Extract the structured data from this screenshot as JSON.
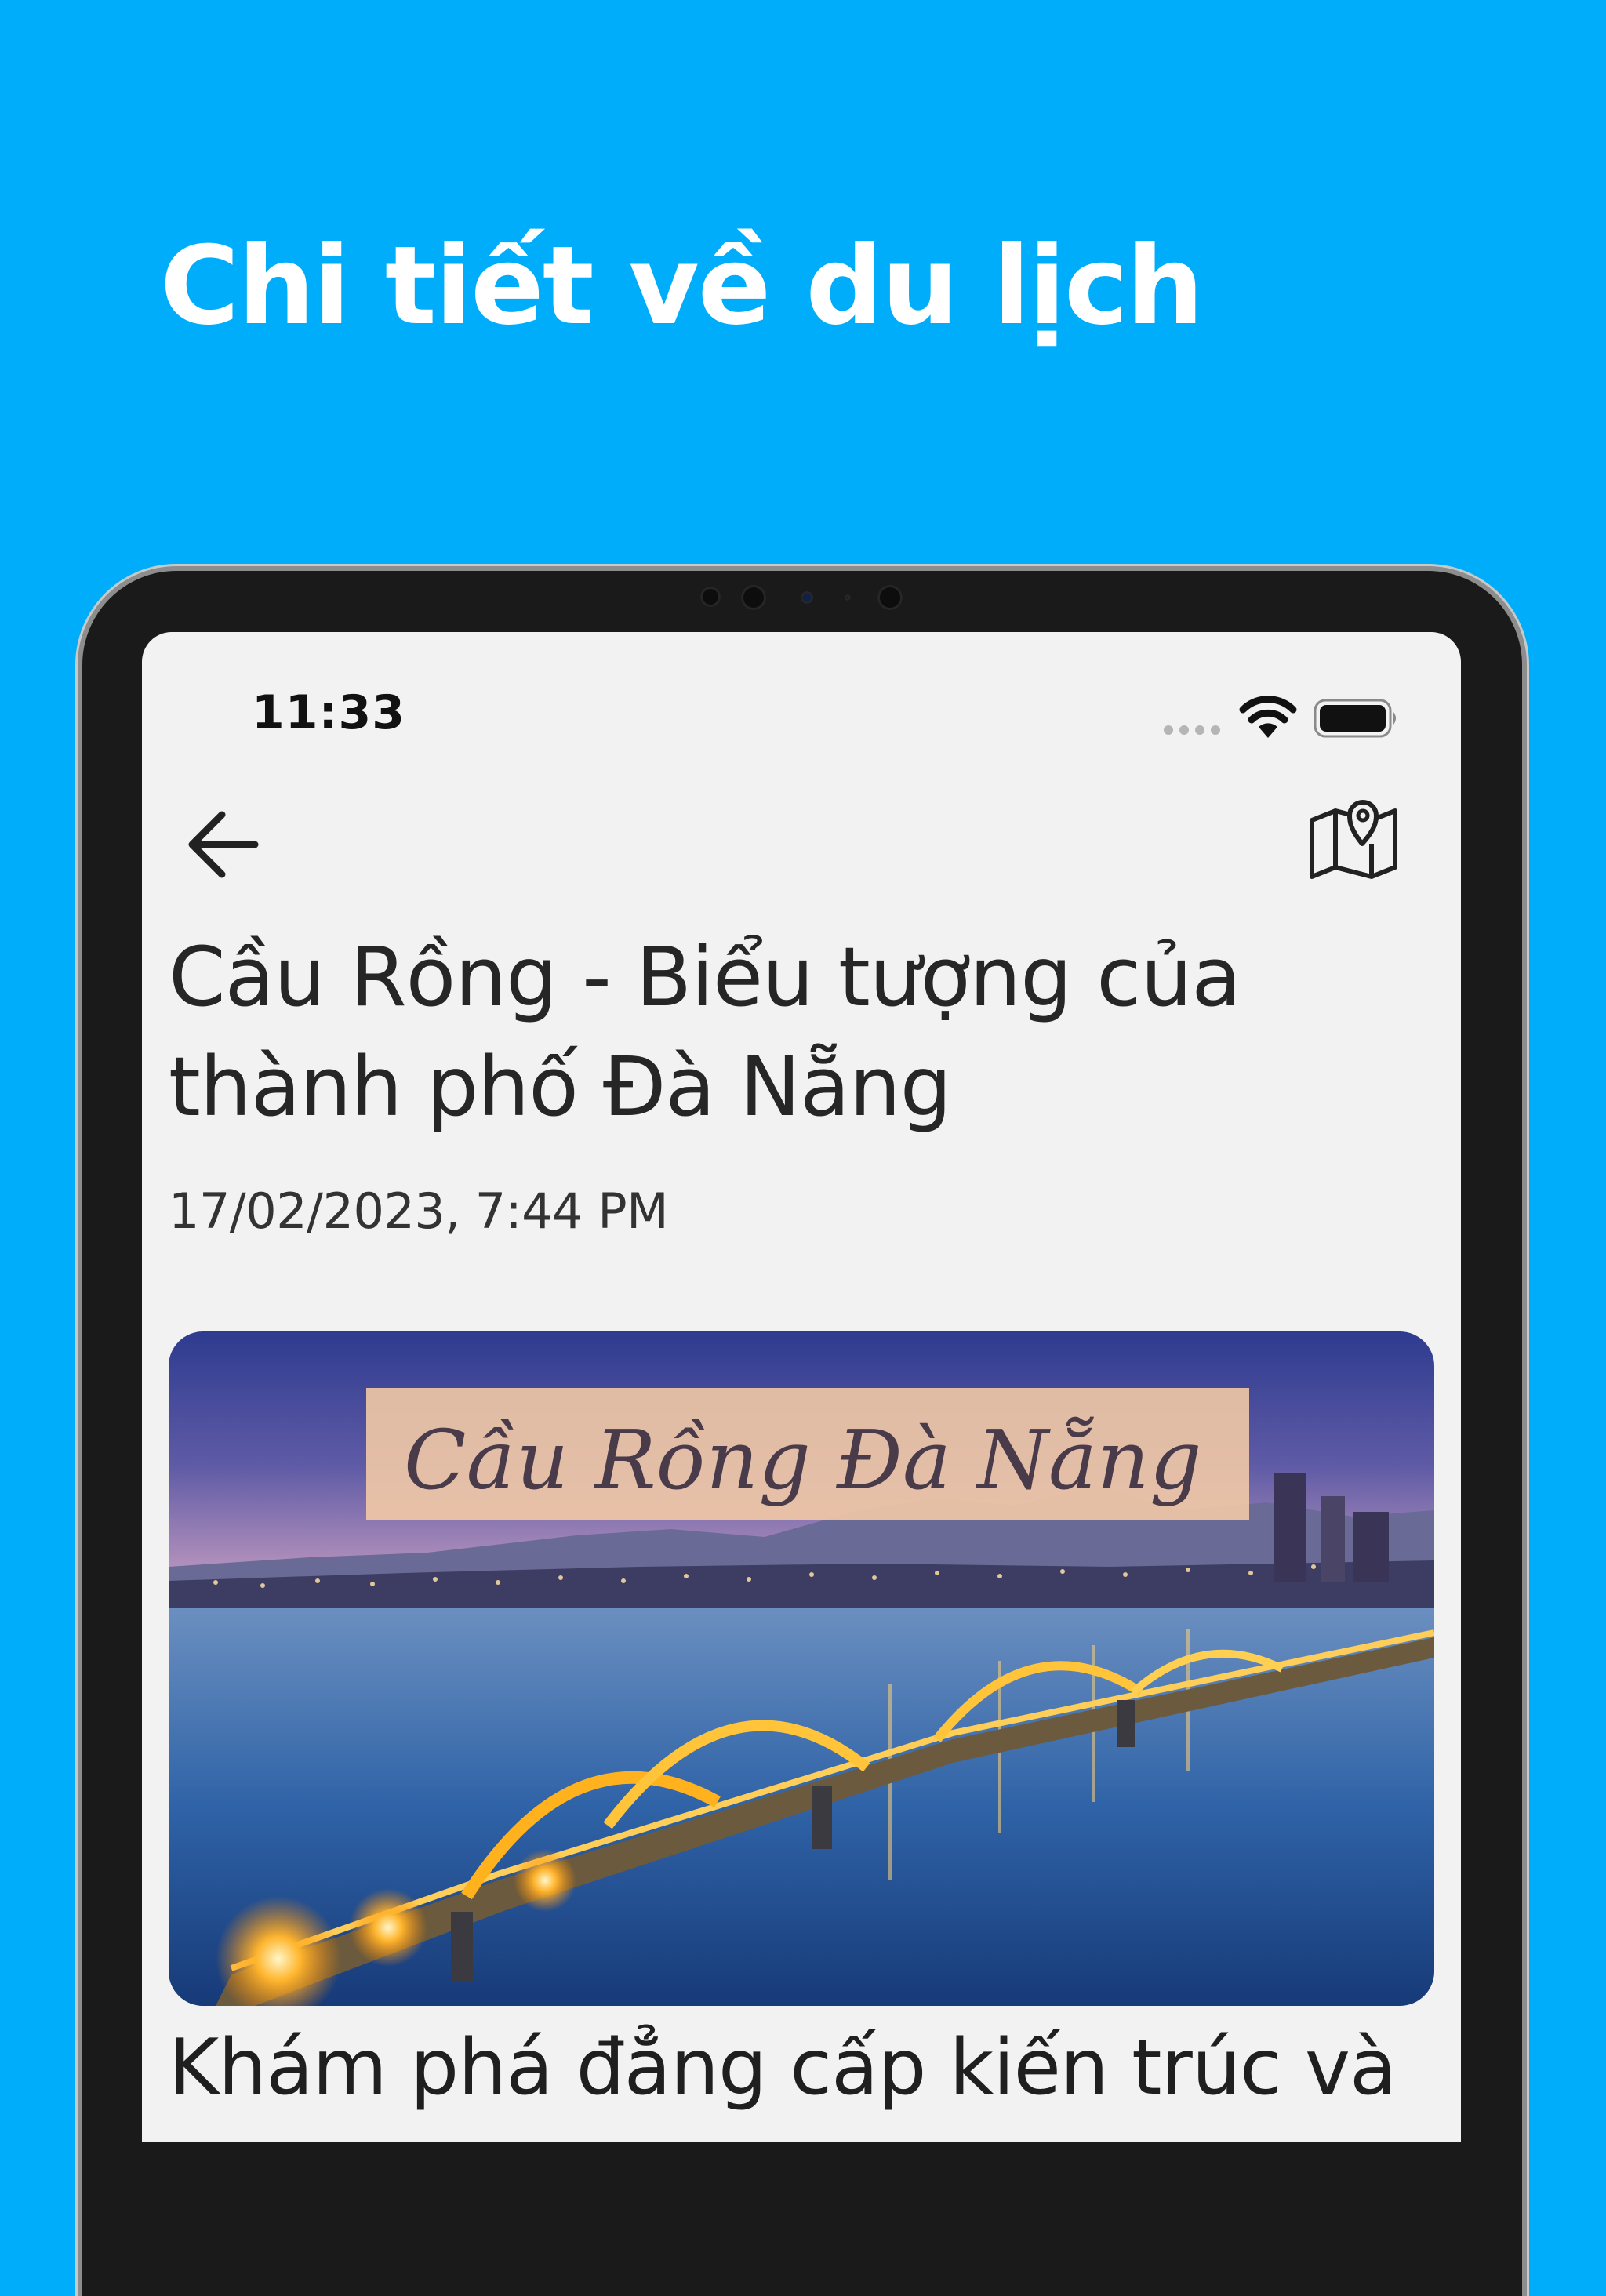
{
  "promo": {
    "headline": "Chi tiết về du lịch"
  },
  "status_bar": {
    "time": "11:33",
    "icons": [
      "cellular-signal-icon",
      "wifi-icon",
      "battery-icon"
    ]
  },
  "nav": {
    "back_icon": "arrow-left-icon",
    "map_icon": "map-pin-icon"
  },
  "article": {
    "title": "Cầu Rồng - Biểu tượng của thành phố Đà Nẵng",
    "date": "17/02/2023, 7:44 PM",
    "image_caption": "Cầu Rồng Đà Nẵng",
    "body": "Khám phá đẳng cấp kiến trúc và văn hóa của Việt Nam thông qua"
  },
  "colors": {
    "background": "#00adfb",
    "screen": "#f3f2f2",
    "device_frame": "#1a1a1a",
    "text": "#262626"
  }
}
